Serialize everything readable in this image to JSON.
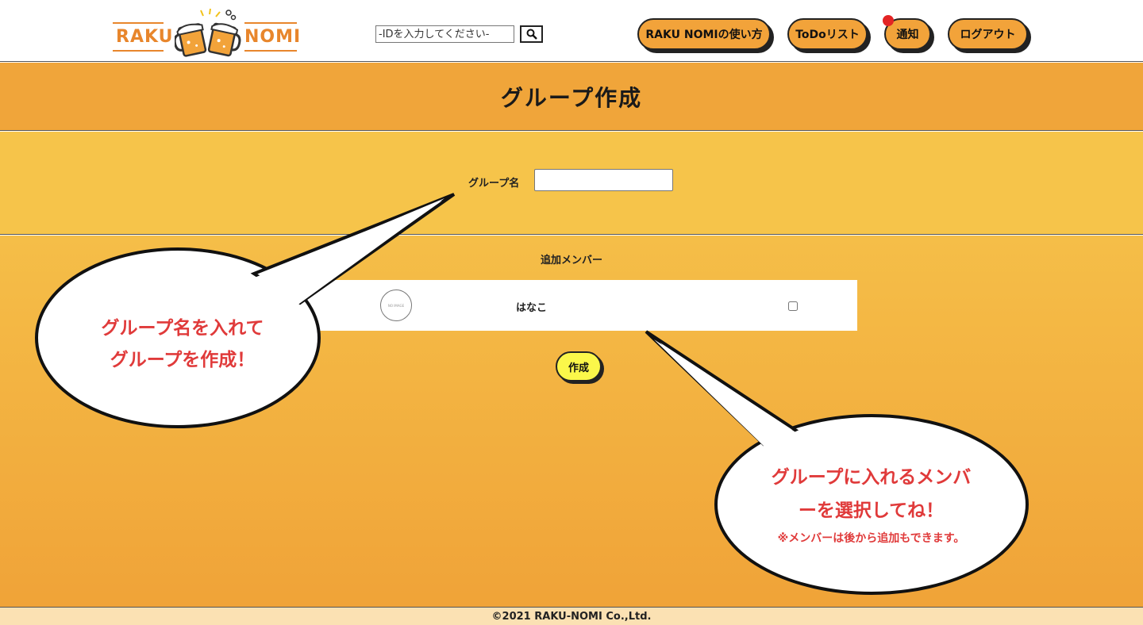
{
  "header": {
    "logo": {
      "left_text": "RAKU",
      "right_text": "NOMI"
    },
    "search": {
      "placeholder": "-IDを入力してください-",
      "button_icon": "search-icon"
    },
    "nav": {
      "how_to_use": "RAKU NOMIの使い方",
      "todo": "ToDoリスト",
      "notifications": "通知",
      "logout": "ログアウト"
    }
  },
  "main": {
    "title": "グループ作成",
    "group_name_label": "グループ名",
    "group_name_value": "",
    "members_heading": "追加メンバー",
    "members": [
      {
        "name": "はなこ",
        "avatar_text": "NO IMAGE",
        "selected": false
      }
    ],
    "create_button": "作成"
  },
  "callouts": {
    "group_name_tip": [
      "グループ名を入れて",
      "グループを作成！"
    ],
    "member_tip": [
      "グループに入れるメンバ",
      "ーを選択してね！"
    ],
    "member_note": "※メンバーは後から追加もできます。"
  },
  "footer": {
    "copyright": "©2021 RAKU-NOMI Co.,Ltd."
  },
  "colors": {
    "accent_orange": "#f0a53a",
    "section_yellow": "#f6c44a",
    "create_button": "#fbf74a",
    "callout_text": "#e03a3a",
    "notification_dot": "#e32424"
  }
}
